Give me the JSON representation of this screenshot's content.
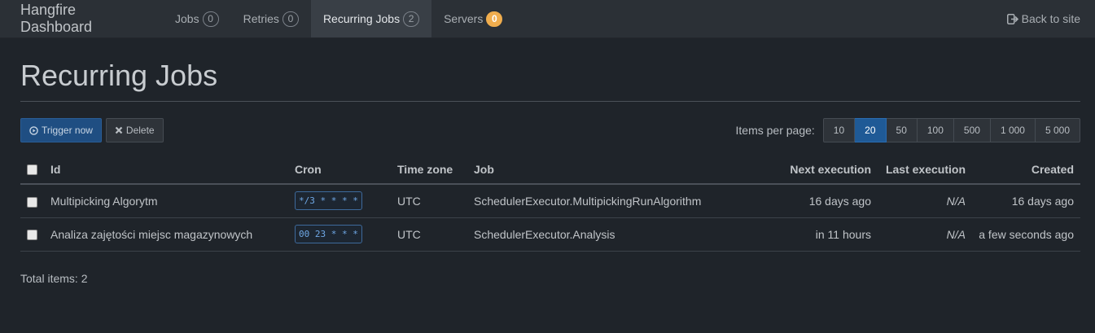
{
  "navbar": {
    "brand": "Hangfire Dashboard",
    "items": [
      {
        "label": "Jobs",
        "badge": "0"
      },
      {
        "label": "Retries",
        "badge": "0"
      },
      {
        "label": "Recurring Jobs",
        "badge": "2"
      },
      {
        "label": "Servers",
        "badge": "0"
      }
    ],
    "back_label": "Back to site"
  },
  "page": {
    "title": "Recurring Jobs"
  },
  "toolbar": {
    "trigger_label": "Trigger now",
    "delete_label": "Delete",
    "items_per_page_label": "Items per page:",
    "page_sizes": [
      "10",
      "20",
      "50",
      "100",
      "500",
      "1 000",
      "5 000"
    ],
    "selected_page_size": "20"
  },
  "table": {
    "headers": {
      "id": "Id",
      "cron": "Cron",
      "timezone": "Time zone",
      "job": "Job",
      "next": "Next execution",
      "last": "Last execution",
      "created": "Created"
    },
    "rows": [
      {
        "id": "Multipicking Algorytm",
        "cron": "*/3 * * * *",
        "timezone": "UTC",
        "job": "SchedulerExecutor.MultipickingRunAlgorithm",
        "next": "16 days ago",
        "last": "N/A",
        "created": "16 days ago"
      },
      {
        "id": "Analiza zajętości miejsc magazynowych",
        "cron": "00 23 * * *",
        "timezone": "UTC",
        "job": "SchedulerExecutor.Analysis",
        "next": "in 11 hours",
        "last": "N/A",
        "created": "a few seconds ago"
      }
    ]
  },
  "footer": {
    "total_label": "Total items: 2"
  },
  "colors": {
    "background": "#1f242a",
    "navbar": "#2b3036",
    "primary": "#1f4e82",
    "warning_badge": "#f0ad4e",
    "cron_text": "#6fa8e6"
  },
  "icons": {
    "trigger": "play-circle-icon",
    "delete": "close-icon",
    "back": "sign-out-icon"
  }
}
